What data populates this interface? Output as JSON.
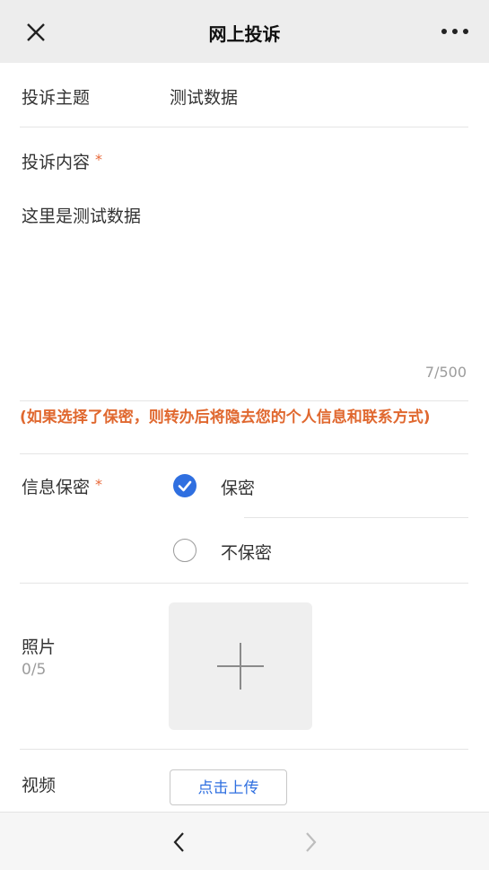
{
  "header": {
    "title": "网上投诉"
  },
  "form": {
    "subject": {
      "label": "投诉主题",
      "value": "测试数据"
    },
    "content": {
      "label": "投诉内容",
      "required_mark": "*",
      "value": "这里是测试数据",
      "counter": "7/500"
    },
    "notice": "(如果选择了保密，则转办后将隐去您的个人信息和联系方式)",
    "privacy": {
      "label": "信息保密",
      "required_mark": "*",
      "options": [
        {
          "label": "保密",
          "selected": true
        },
        {
          "label": "不保密",
          "selected": false
        }
      ]
    },
    "photo": {
      "label": "照片",
      "count": "0/5"
    },
    "video": {
      "label": "视频",
      "button": "点击上传"
    }
  },
  "colors": {
    "accent": "#2f6fe0",
    "notice": "#e0682f",
    "header_bg": "#ededed"
  },
  "icons": {
    "close": "close-icon",
    "more": "more-icon",
    "add": "plus-icon",
    "back": "chevron-left-icon",
    "forward": "chevron-right-icon"
  }
}
